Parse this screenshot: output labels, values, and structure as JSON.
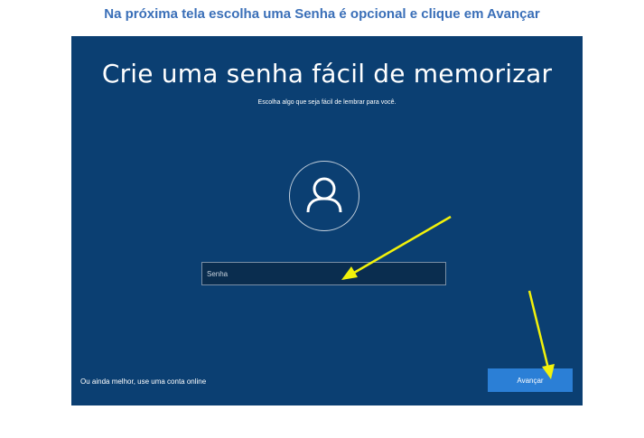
{
  "caption": "Na próxima tela escolha uma Senha é opcional e clique em Avançar",
  "setup_screen": {
    "title": "Crie uma senha fácil de memorizar",
    "subtitle": "Escolha algo que seja fácil de lembrar para você.",
    "avatar_icon": "user-icon",
    "password_field": {
      "placeholder": "Senha",
      "value": ""
    },
    "online_account_link": "Ou ainda melhor, use uma conta online",
    "next_button": "Avançar"
  },
  "colors": {
    "caption": "#3a6fb8",
    "screen_background": "#0b3f72",
    "button": "#2b7fd6",
    "annotation_arrow": "#f2f20a"
  }
}
